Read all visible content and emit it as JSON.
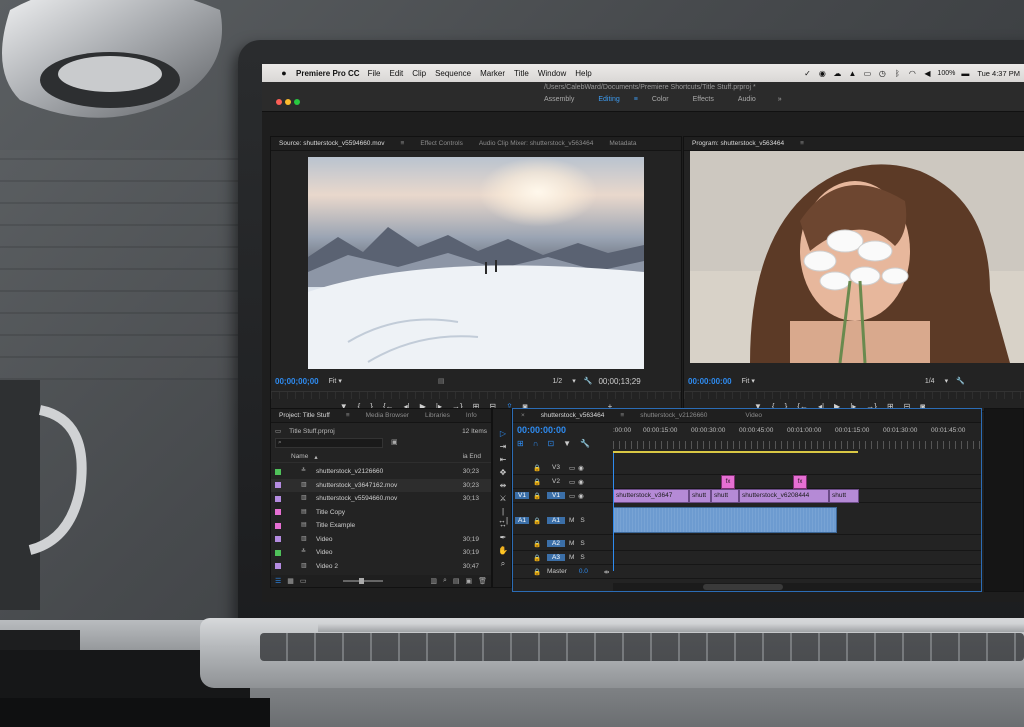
{
  "menubar": {
    "app_name": "Premiere Pro CC",
    "items": [
      "File",
      "Edit",
      "Clip",
      "Sequence",
      "Marker",
      "Title",
      "Window",
      "Help"
    ],
    "battery": "100%",
    "clock": "Tue 4:37 PM"
  },
  "window": {
    "path": "/Users/CalebWard/Documents/Premiere Shortcuts/Title Stuff.prproj *",
    "workspaces": [
      "Assembly",
      "Editing",
      "Color",
      "Effects",
      "Audio"
    ],
    "active_workspace": "Editing"
  },
  "source_monitor": {
    "tabs": [
      "Source: shutterstock_v5594660.mov",
      "Effect Controls",
      "Audio Clip Mixer: shutterstock_v563464",
      "Metadata"
    ],
    "timecode": "00;00;00;00",
    "fit": "Fit",
    "resolution": "1/2",
    "duration": "00;00;13;29"
  },
  "program_monitor": {
    "tab": "Program: shutterstock_v563464",
    "timecode": "00:00:00:00",
    "fit": "Fit",
    "resolution": "1/4"
  },
  "project_panel": {
    "tabs": [
      "Project: Title Stuff",
      "Media Browser",
      "Libraries",
      "Info"
    ],
    "project_file": "Title Stuff.prproj",
    "item_count": "12 Items",
    "col_name": "Name",
    "col_end": "ia End",
    "items": [
      {
        "name": "shutterstock_v2126660",
        "duration": "30;23",
        "color": "#4fc15a",
        "icon": "sequence-icon"
      },
      {
        "name": "shutterstock_v3647162.mov",
        "duration": "30;23",
        "color": "#b48be0",
        "icon": "film-icon"
      },
      {
        "name": "shutterstock_v5594660.mov",
        "duration": "30;13",
        "color": "#b48be0",
        "icon": "film-icon"
      },
      {
        "name": "Title Copy",
        "duration": "",
        "color": "#e66fd3",
        "icon": "title-icon"
      },
      {
        "name": "Title Example",
        "duration": "",
        "color": "#e66fd3",
        "icon": "title-icon"
      },
      {
        "name": "Video",
        "duration": "30;19",
        "color": "#b48be0",
        "icon": "film-icon"
      },
      {
        "name": "Video",
        "duration": "30;19",
        "color": "#4fc15a",
        "icon": "sequence-icon"
      },
      {
        "name": "Video 2",
        "duration": "30;47",
        "color": "#b48be0",
        "icon": "film-icon"
      }
    ]
  },
  "timeline": {
    "tabs": [
      "shutterstock_v563464",
      "shutterstock_v2126660",
      "Video"
    ],
    "timecode": "00:00:00:00",
    "ruler_labels": [
      ":00:00",
      "00:00:15:00",
      "00:00:30:00",
      "00:00:45:00",
      "00:01:00:00",
      "00:01:15:00",
      "00:01:30:00",
      "00:01:45:00"
    ],
    "tracks": {
      "v3": "V3",
      "v2": "V2",
      "v1": "V1",
      "a1": "A1",
      "a2": "A2",
      "a3": "A3",
      "src_v": "V1",
      "src_a": "A1",
      "master": "Master",
      "master_val": "0.0",
      "m": "M",
      "s": "S"
    },
    "video_clips": [
      "shutterstock_v3647",
      "shutt",
      "shutt",
      "shutterstock_v6208444",
      "shutt"
    ]
  },
  "colors": {
    "accent": "#2e8bf0",
    "clip_video": "#b58ad6",
    "clip_title": "#e66fd3",
    "clip_audio": "#6d9bd0",
    "workbar": "#d9c744"
  }
}
